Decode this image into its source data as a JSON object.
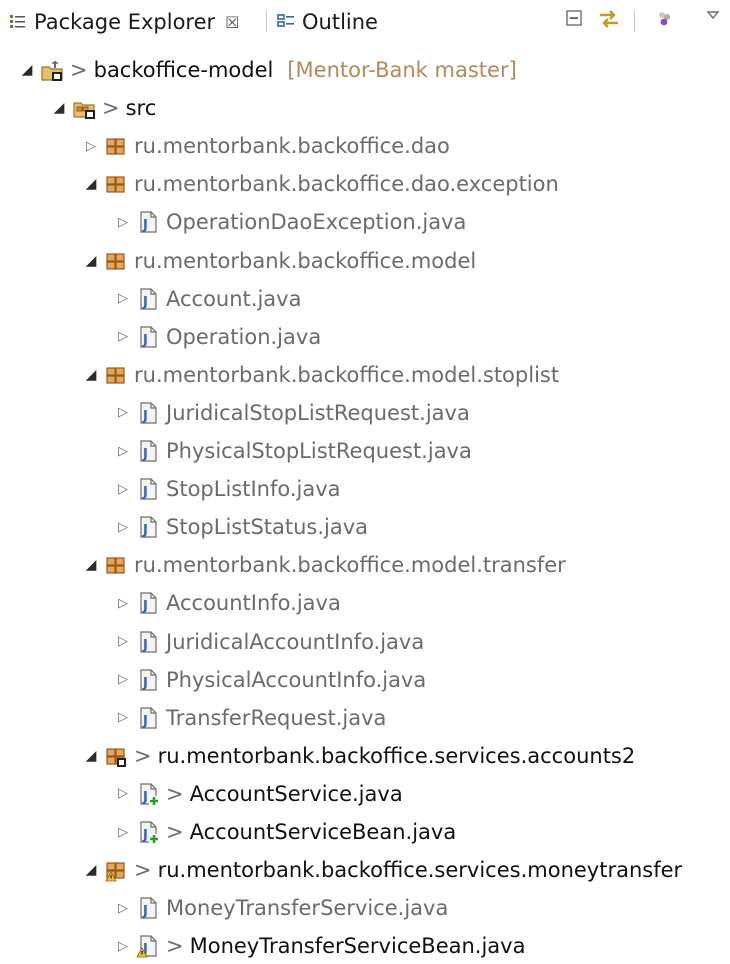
{
  "tabs": {
    "package_explorer": "Package Explorer",
    "close_glyph": "☒",
    "outline": "Outline"
  },
  "tree": {
    "project": {
      "name": "backoffice-model",
      "decoration": "[Mentor-Bank master]",
      "dirty_marker": ">"
    },
    "src": {
      "name": "src",
      "dirty_marker": ">"
    },
    "packages": [
      {
        "name": "ru.mentorbank.backoffice.dao",
        "expanded": false,
        "dirty": false,
        "files": []
      },
      {
        "name": "ru.mentorbank.backoffice.dao.exception",
        "expanded": true,
        "dirty": false,
        "files": [
          {
            "name": "OperationDaoException.java",
            "dirty": false
          }
        ]
      },
      {
        "name": "ru.mentorbank.backoffice.model",
        "expanded": true,
        "dirty": false,
        "files": [
          {
            "name": "Account.java",
            "dirty": false
          },
          {
            "name": "Operation.java",
            "dirty": false
          }
        ]
      },
      {
        "name": "ru.mentorbank.backoffice.model.stoplist",
        "expanded": true,
        "dirty": false,
        "files": [
          {
            "name": "JuridicalStopListRequest.java",
            "dirty": false
          },
          {
            "name": "PhysicalStopListRequest.java",
            "dirty": false
          },
          {
            "name": "StopListInfo.java",
            "dirty": false
          },
          {
            "name": "StopListStatus.java",
            "dirty": false
          }
        ]
      },
      {
        "name": "ru.mentorbank.backoffice.model.transfer",
        "expanded": true,
        "dirty": false,
        "files": [
          {
            "name": "AccountInfo.java",
            "dirty": false
          },
          {
            "name": "JuridicalAccountInfo.java",
            "dirty": false
          },
          {
            "name": "PhysicalAccountInfo.java",
            "dirty": false
          },
          {
            "name": "TransferRequest.java",
            "dirty": false
          }
        ]
      },
      {
        "name": "ru.mentorbank.backoffice.services.accounts2",
        "expanded": true,
        "dirty": true,
        "files": [
          {
            "name": "AccountService.java",
            "dirty": true,
            "added": true
          },
          {
            "name": "AccountServiceBean.java",
            "dirty": true,
            "added": true
          }
        ]
      },
      {
        "name": "ru.mentorbank.backoffice.services.moneytransfer",
        "expanded": true,
        "dirty": true,
        "warning": true,
        "files": [
          {
            "name": "MoneyTransferService.java",
            "dirty": false
          },
          {
            "name": "MoneyTransferServiceBean.java",
            "dirty": true,
            "warning": true
          }
        ]
      }
    ]
  },
  "colors": {
    "package_icon": "#b5651d",
    "java_icon": "#2f64b8",
    "clean_label": "#6b6b6b",
    "dirty_label": "#111111",
    "decoration": "#b5895a"
  }
}
